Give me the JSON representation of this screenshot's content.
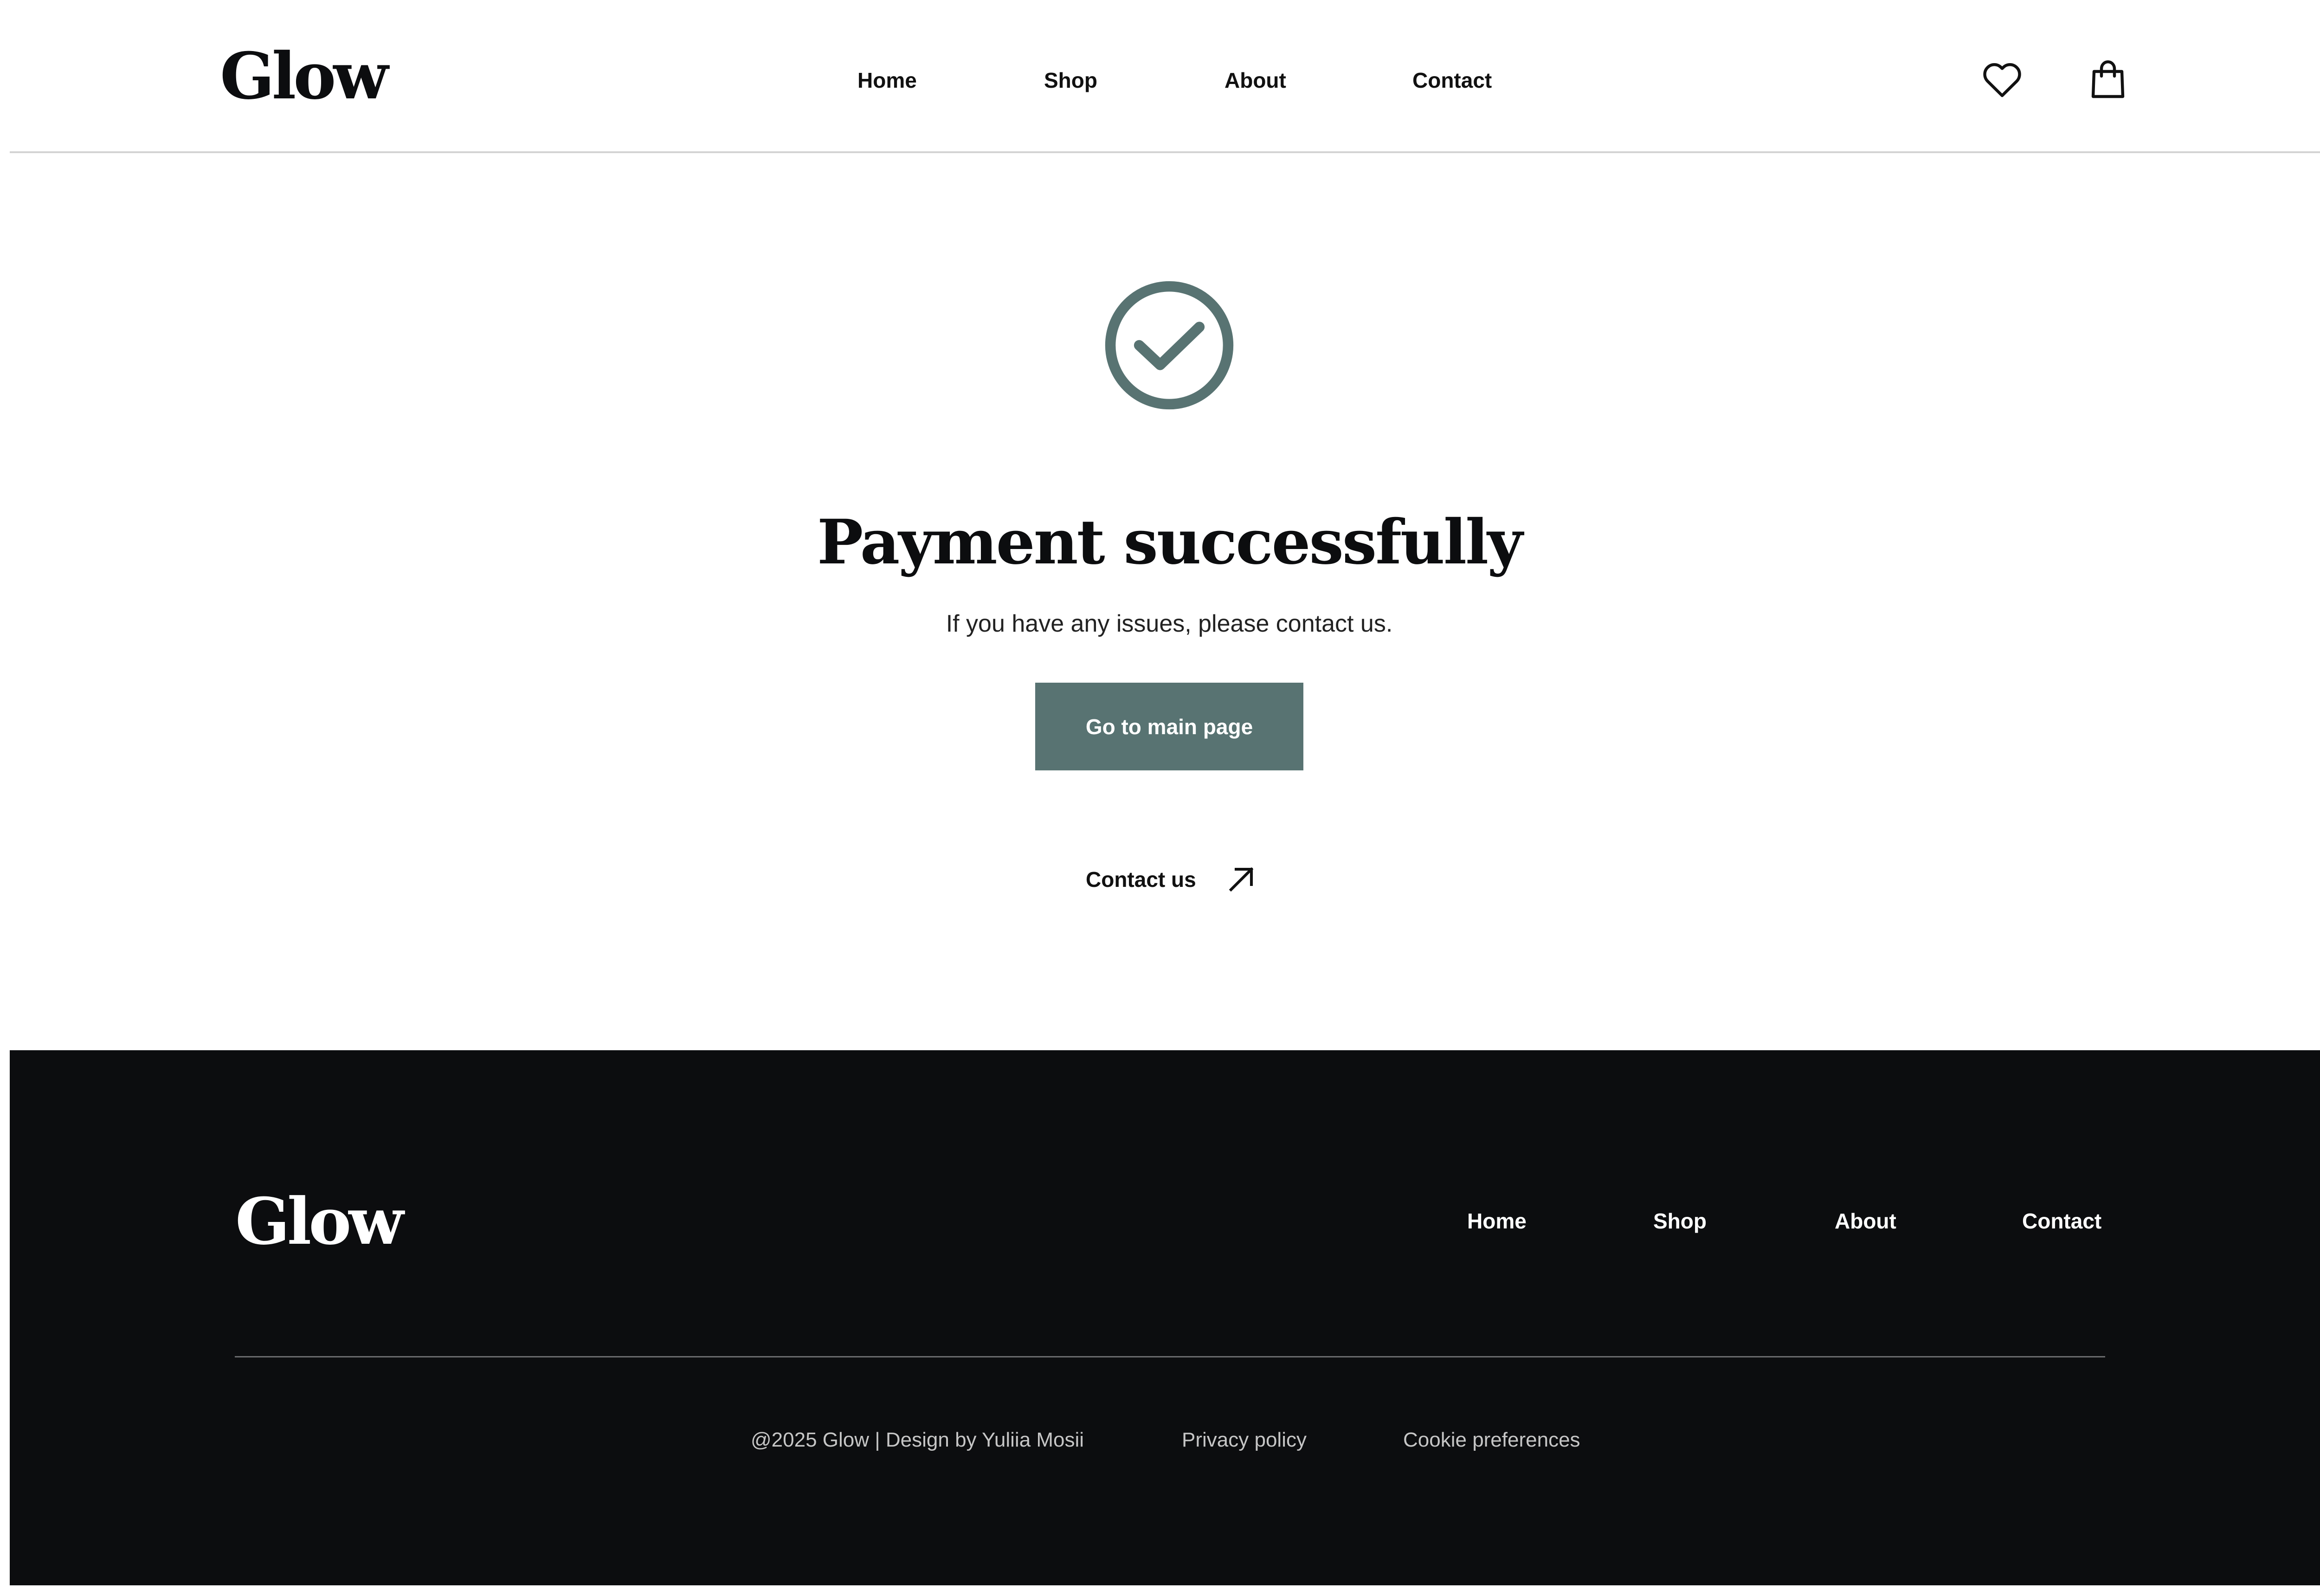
{
  "header": {
    "logo": "Glow",
    "nav": {
      "home": "Home",
      "shop": "Shop",
      "about": "About",
      "contact": "Contact"
    },
    "icons": [
      "heart-icon",
      "shopping-bag-icon"
    ]
  },
  "main": {
    "icon": "check-circle-icon",
    "title": "Payment successfully",
    "subtitle": "If you have any issues, please contact us.",
    "main_button_label": "Go to main page",
    "contact_link_label": "Contact us",
    "contact_link_icon": "arrow-up-right-icon"
  },
  "footer": {
    "logo": "Glow",
    "nav": {
      "home": "Home",
      "shop": "Shop",
      "about": "About",
      "contact": "Contact"
    },
    "copyright": "@2025 Glow | Design by Yuliia Mosii",
    "privacy": "Privacy policy",
    "cookie": "Cookie preferences"
  },
  "colors": {
    "accent": "#587372",
    "text_dark": "#0c0d0f",
    "footer_bg": "#0c0d0f",
    "footer_text_muted": "#c6c6c6",
    "divider": "#d4d4d4"
  }
}
